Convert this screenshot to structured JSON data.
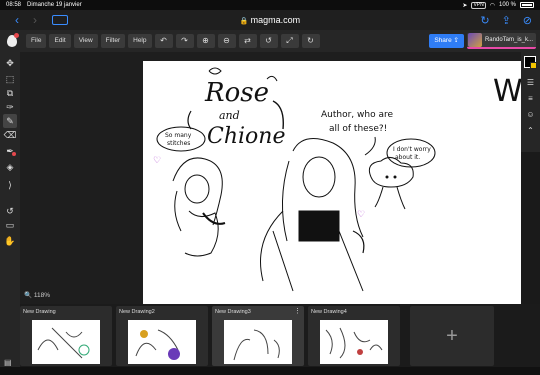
{
  "status": {
    "time": "08:58",
    "date": "Dimanche 19 janvier",
    "vpn": "VPN",
    "battery": "100 %"
  },
  "browser": {
    "url": "magma.com"
  },
  "toolbar": {
    "menus": [
      "File",
      "Edit",
      "View",
      "Filter",
      "Help"
    ],
    "share_label": "Share",
    "user_name": "RandoTam_is_k..."
  },
  "workspace": {
    "zoom_label": "118%",
    "canvas_text": {
      "title_line1": "Rose",
      "title_line2": "and",
      "title_line3": "Chione",
      "bubble_left": "So many",
      "bubble_left2": "stitches",
      "question": "Author, who are",
      "question2": "all of these?!",
      "answer": "I don't worry",
      "answer2": "about it.",
      "edge_text": "WH"
    }
  },
  "drawings": [
    {
      "title": "New Drawing"
    },
    {
      "title": "New Drawing2"
    },
    {
      "title": "New Drawing3"
    },
    {
      "title": "New Drawing4"
    }
  ],
  "colors": {
    "accent": "#2f7df6",
    "user_underline": "#e84aa8",
    "primary_color": "#000000",
    "secondary_color": "#f3c400"
  }
}
